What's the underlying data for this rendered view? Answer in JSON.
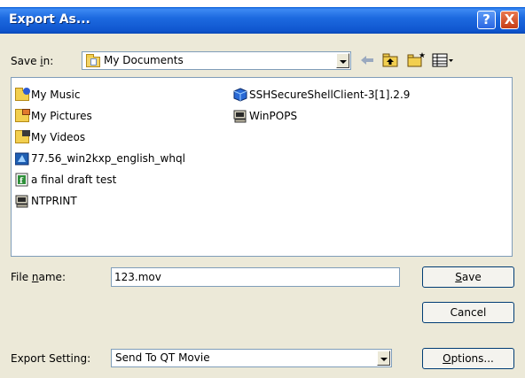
{
  "window": {
    "title": "Export As...",
    "help_glyph": "?",
    "close_glyph": "X"
  },
  "save_in": {
    "label_prefix": "Save ",
    "label_mnemonic": "i",
    "label_suffix": "n:",
    "value": "My Documents"
  },
  "toolbar": {
    "back_icon": "back-arrow-icon",
    "up_icon": "up-one-level-icon",
    "new_folder_icon": "new-folder-icon",
    "views_icon": "views-menu-icon"
  },
  "files": [
    {
      "name": "My Music",
      "icon": "music-folder-icon"
    },
    {
      "name": "My Pictures",
      "icon": "pictures-folder-icon"
    },
    {
      "name": "My Videos",
      "icon": "videos-folder-icon"
    },
    {
      "name": "77.56_win2kxp_english_whql",
      "icon": "installer-icon"
    },
    {
      "name": "a final draft test",
      "icon": "document-icon"
    },
    {
      "name": "NTPRINT",
      "icon": "computer-shortcut-icon"
    },
    {
      "name": "SSHSecureShellClient-3[1].2.9",
      "icon": "package-icon"
    },
    {
      "name": "WinPOPS",
      "icon": "computer-shortcut-icon"
    }
  ],
  "file_name": {
    "label_prefix": "File ",
    "label_mnemonic": "n",
    "label_suffix": "ame:",
    "value": "123.mov"
  },
  "export_setting": {
    "label": "Export Setting:",
    "value": "Send To QT Movie"
  },
  "buttons": {
    "save_mnemonic": "S",
    "save_rest": "ave",
    "cancel": "Cancel",
    "options_mnemonic": "O",
    "options_rest": "ptions..."
  },
  "colors": {
    "titlebar": "#0a5fd8",
    "dialog_bg": "#ece9d8",
    "field_border": "#7f9db9"
  }
}
